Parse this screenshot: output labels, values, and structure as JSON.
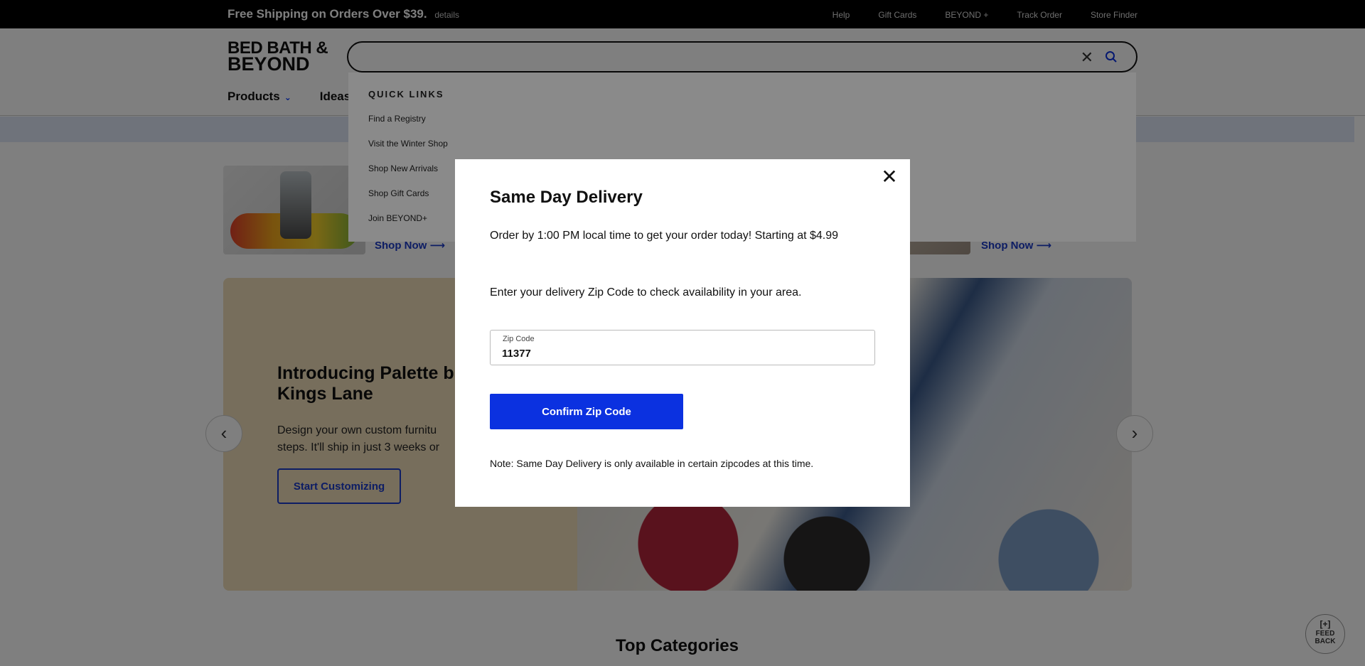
{
  "topbar": {
    "promo": "Free Shipping on Orders Over $39.",
    "details": "details",
    "links": [
      "Help",
      "Gift Cards",
      "BEYOND +",
      "Track Order",
      "Store Finder"
    ]
  },
  "header": {
    "logo_line1": "BED BATH &",
    "logo_line2": "BEYOND",
    "search": {
      "value": "",
      "placeholder": ""
    },
    "nav": {
      "products": "Products",
      "ideas": "Ideas"
    }
  },
  "quick_links": {
    "title": "QUICK LINKS",
    "items": [
      "Find a Registry",
      "Visit the Winter Shop",
      "Shop New Arrivals",
      "Shop Gift Cards",
      "Join BEYOND+"
    ]
  },
  "promos": {
    "left_cta": "Shop Now ⟶",
    "right_cta": "Shop Now ⟶"
  },
  "hero": {
    "title": "Introducing Palette b\nKings Lane",
    "body": "Design your own custom furnitu\nsteps. It'll ship in just 3 weeks or",
    "cta": "Start Customizing"
  },
  "carousel": {
    "prev_icon": "chevron-left-icon",
    "next_icon": "chevron-right-icon"
  },
  "sections": {
    "top_categories": "Top Categories"
  },
  "feedback": {
    "line1": "FEED",
    "line2": "BACK"
  },
  "modal": {
    "title": "Same Day Delivery",
    "text1": "Order by 1:00 PM local time to get your order today! Starting at $4.99",
    "text2": "Enter your delivery Zip Code to check availability in your area.",
    "zip_label": "Zip Code",
    "zip_value": "11377",
    "confirm": "Confirm Zip Code",
    "note": "Note: Same Day Delivery is only available in certain zipcodes at this time."
  },
  "colors": {
    "brand_blue": "#0b31e0",
    "link_blue": "#1b3ac9",
    "hero_bg": "#eedcb9"
  }
}
